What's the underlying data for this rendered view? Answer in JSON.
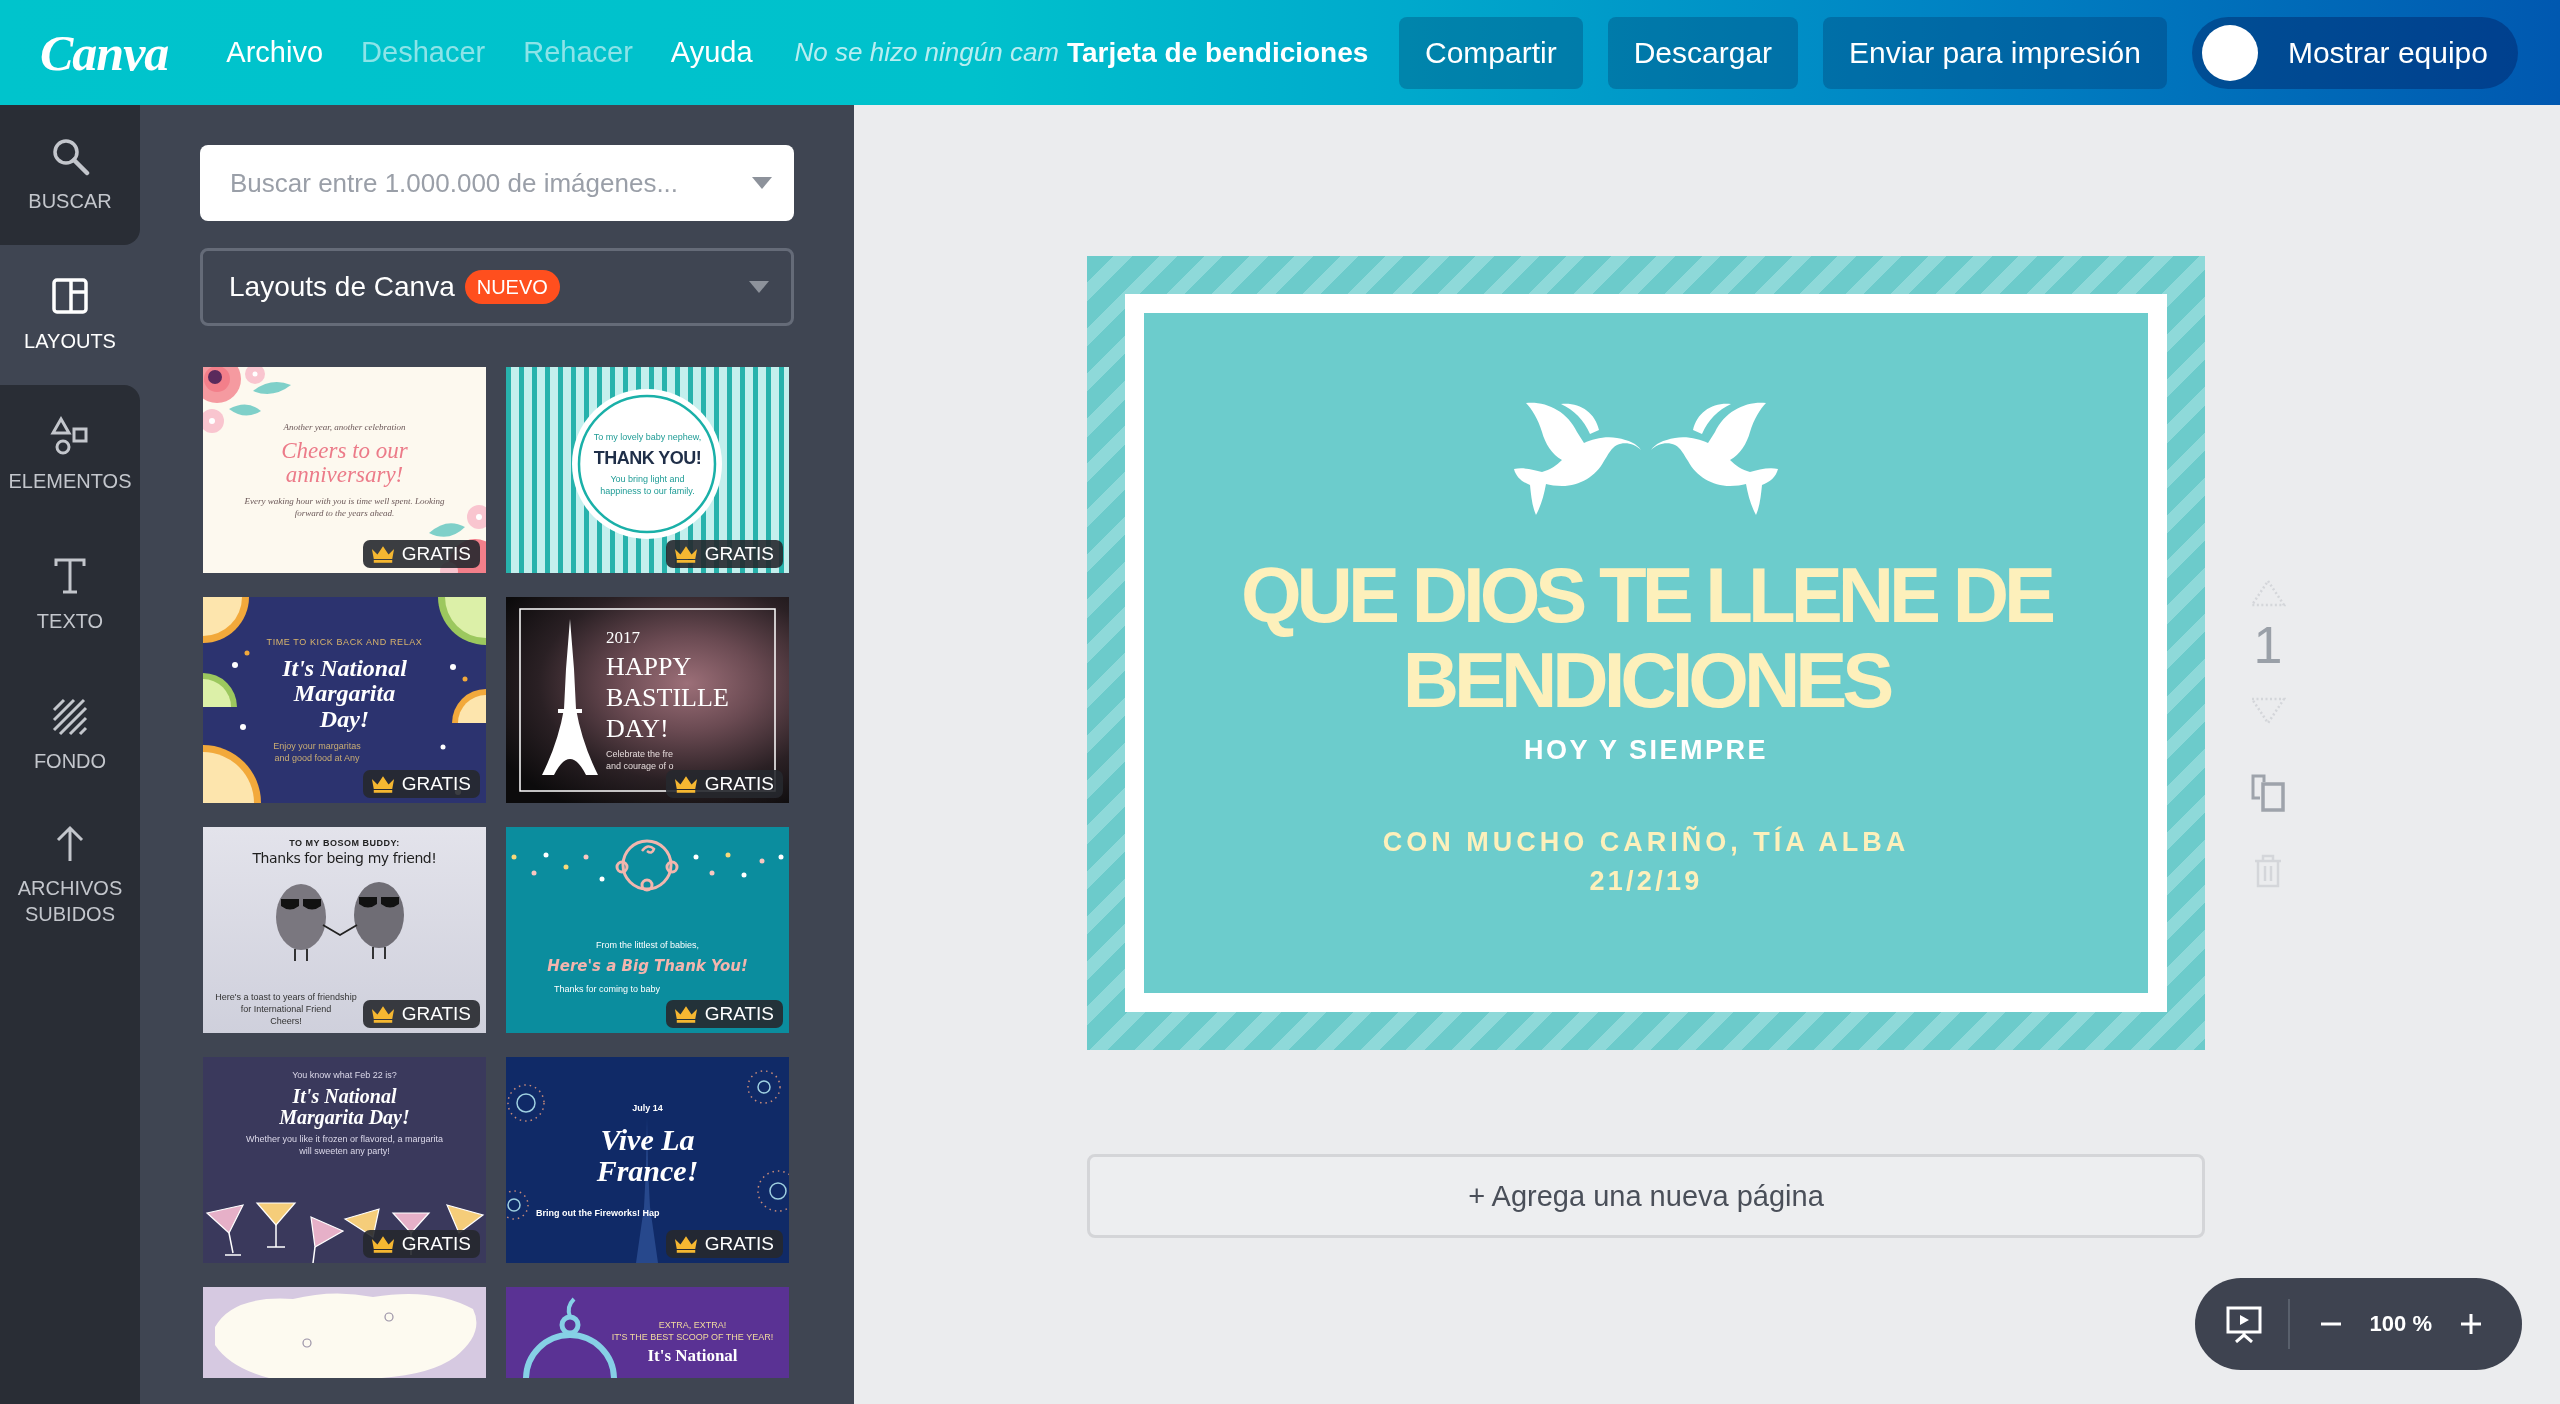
{
  "topbar": {
    "logo": "Canva",
    "menu": [
      {
        "label": "Archivo",
        "disabled": false
      },
      {
        "label": "Deshacer",
        "disabled": true
      },
      {
        "label": "Rehacer",
        "disabled": true
      },
      {
        "label": "Ayuda",
        "disabled": false
      }
    ],
    "status": "No se hizo ningún cam",
    "title": "Tarjeta de bendiciones",
    "buttons": [
      "Compartir",
      "Descargar",
      "Enviar para impresión"
    ],
    "team_toggle": {
      "label": "Mostrar equipo",
      "on": false
    }
  },
  "sidebar": {
    "items": [
      {
        "kind": "search",
        "label": "BUSCAR",
        "selected": false
      },
      {
        "kind": "layouts",
        "label": "LAYOUTS",
        "selected": true
      },
      {
        "kind": "elements",
        "label": "ELEMENTOS",
        "selected": false
      },
      {
        "kind": "text",
        "label": "TEXTO",
        "selected": false
      },
      {
        "kind": "background",
        "label": "FONDO",
        "selected": false
      },
      {
        "kind": "uploads",
        "label": "ARCHIVOS SUBIDOS",
        "selected": false
      }
    ]
  },
  "panel": {
    "search": {
      "placeholder": "Buscar entre 1.000.000 de imágenes..."
    },
    "dropdown": {
      "label": "Layouts de Canva",
      "badge": "NUEVO"
    },
    "templates": [
      {
        "kind": "floral",
        "texts": [
          {
            "kind": "kicker",
            "text": "Another year, another celebration"
          },
          {
            "kind": "title",
            "text": "Cheers to our anniversary!"
          },
          {
            "kind": "footer",
            "text": "Every waking hour with you is time well spent. Looking forward to the years ahead."
          }
        ],
        "badge": "GRATIS"
      },
      {
        "kind": "stripes",
        "texts": [
          {
            "kind": "kicker",
            "text": "To my lovely baby nephew,"
          },
          {
            "kind": "title",
            "text": "THANK YOU!"
          },
          {
            "kind": "footer",
            "text": "You bring light and happiness to our family."
          }
        ],
        "badge": "GRATIS"
      },
      {
        "kind": "citrus",
        "texts": [
          {
            "kind": "kicker",
            "text": "TIME TO KICK BACK AND RELAX"
          },
          {
            "kind": "title",
            "text": "It's National Margarita Day!"
          },
          {
            "kind": "footer",
            "text": "Enjoy your margaritas and good food at Any"
          }
        ],
        "badge": "GRATIS"
      },
      {
        "kind": "bastille",
        "texts": [
          {
            "kind": "kicker",
            "text": "2017"
          },
          {
            "kind": "title",
            "text": "HAPPY BASTILLE DAY!"
          },
          {
            "kind": "footer",
            "text": "Celebrate the fre and courage of o"
          }
        ],
        "badge": "GRATIS"
      },
      {
        "kind": "pebbles",
        "texts": [
          {
            "kind": "kicker",
            "text": "TO MY BOSOM BUDDY:"
          },
          {
            "kind": "title",
            "text": "Thanks for being my friend!"
          },
          {
            "kind": "footer",
            "text": "Here's a toast to years of friendship for International Friend"
          },
          {
            "kind": "footer",
            "text": "Cheers!"
          }
        ],
        "badge": "GRATIS"
      },
      {
        "kind": "baby",
        "texts": [
          {
            "kind": "kicker",
            "text": "From the littlest of babies,"
          },
          {
            "kind": "title",
            "text": "Here's a Big Thank You!"
          },
          {
            "kind": "footer",
            "text": "Thanks for coming to baby"
          }
        ],
        "badge": "GRATIS"
      },
      {
        "kind": "cocktails",
        "texts": [
          {
            "kind": "kicker",
            "text": "You know what Feb 22 is?"
          },
          {
            "kind": "title",
            "text": "It's National Margarita Day!"
          },
          {
            "kind": "footer",
            "text": "Whether you like it frozen or flavored, a margarita will sweeten any party!"
          }
        ],
        "badge": "GRATIS"
      },
      {
        "kind": "fireworks",
        "texts": [
          {
            "kind": "kicker",
            "text": "July 14"
          },
          {
            "kind": "title",
            "text": "Vive La France!"
          },
          {
            "kind": "footer",
            "text": "Bring out the Fireworks! Hap"
          }
        ],
        "badge": "GRATIS"
      },
      {
        "kind": "map"
      },
      {
        "kind": "cloche",
        "texts": [
          {
            "kind": "kicker",
            "text": "EXTRA, EXTRA!"
          },
          {
            "kind": "kicker",
            "text": "IT'S THE BEST SCOOP OF THE YEAR!"
          },
          {
            "kind": "title",
            "text": "It's National"
          }
        ]
      }
    ]
  },
  "canvas": {
    "card": {
      "headline": "QUE DIOS TE LLENE DE BENDICIONES",
      "subtitle": "HOY Y SIEMPRE",
      "signature": "CON MUCHO CARIÑO, TÍA ALBA",
      "date": "21/2/19"
    },
    "page_tools": [
      {
        "kind": "move-up",
        "disabled": true
      },
      {
        "kind": "page-number",
        "text": "1"
      },
      {
        "kind": "move-down",
        "disabled": true
      },
      {
        "kind": "duplicate",
        "disabled": false
      },
      {
        "kind": "delete",
        "disabled": true
      }
    ],
    "add_page": "+ Agrega una nueva página",
    "zoom": {
      "value": "100 %"
    }
  }
}
